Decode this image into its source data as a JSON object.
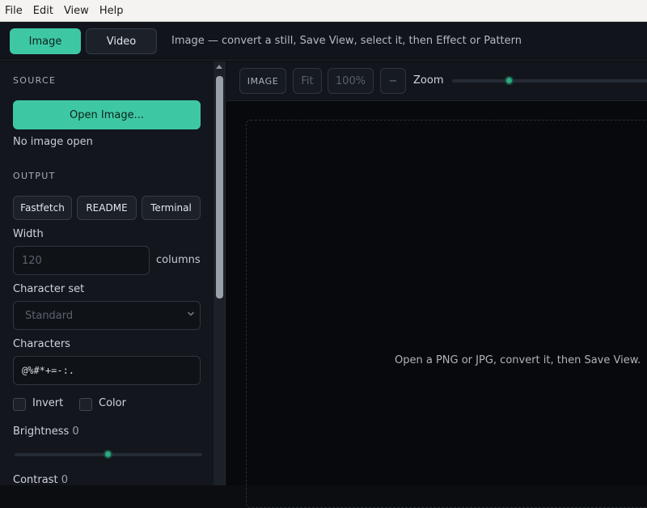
{
  "menu": [
    "File",
    "Edit",
    "View",
    "Help"
  ],
  "mode": {
    "image_label": "Image",
    "video_label": "Video",
    "hint": "Image — convert a still, Save View, select it, then Effect or Pattern"
  },
  "sidebar": {
    "source_title": "SOURCE",
    "open_label": "Open Image...",
    "status": "No image open",
    "output_title": "OUTPUT",
    "presets": [
      "Fastfetch",
      "README",
      "Terminal"
    ],
    "width_label": "Width",
    "width_placeholder": "120",
    "width_unit": "columns",
    "charset_label": "Character set",
    "charset_value": "Standard",
    "characters_label": "Characters",
    "characters_value": "@%#*+=-:.",
    "invert_label": "Invert",
    "color_label": "Color",
    "brightness_label": "Brightness",
    "brightness_value": "0",
    "contrast_label": "Contrast",
    "contrast_value": "0"
  },
  "toolbar": {
    "image_label": "IMAGE",
    "fit_label": "Fit",
    "zoom_value": "100%",
    "minus_label": "−",
    "zoom_label": "Zoom",
    "zoom_level": 0.27
  },
  "canvas": {
    "message": "Open a PNG or JPG, convert it, then Save View."
  },
  "colors": {
    "accent": "#3ec7a3",
    "background": "#0b0d11",
    "panel": "#13161c"
  }
}
